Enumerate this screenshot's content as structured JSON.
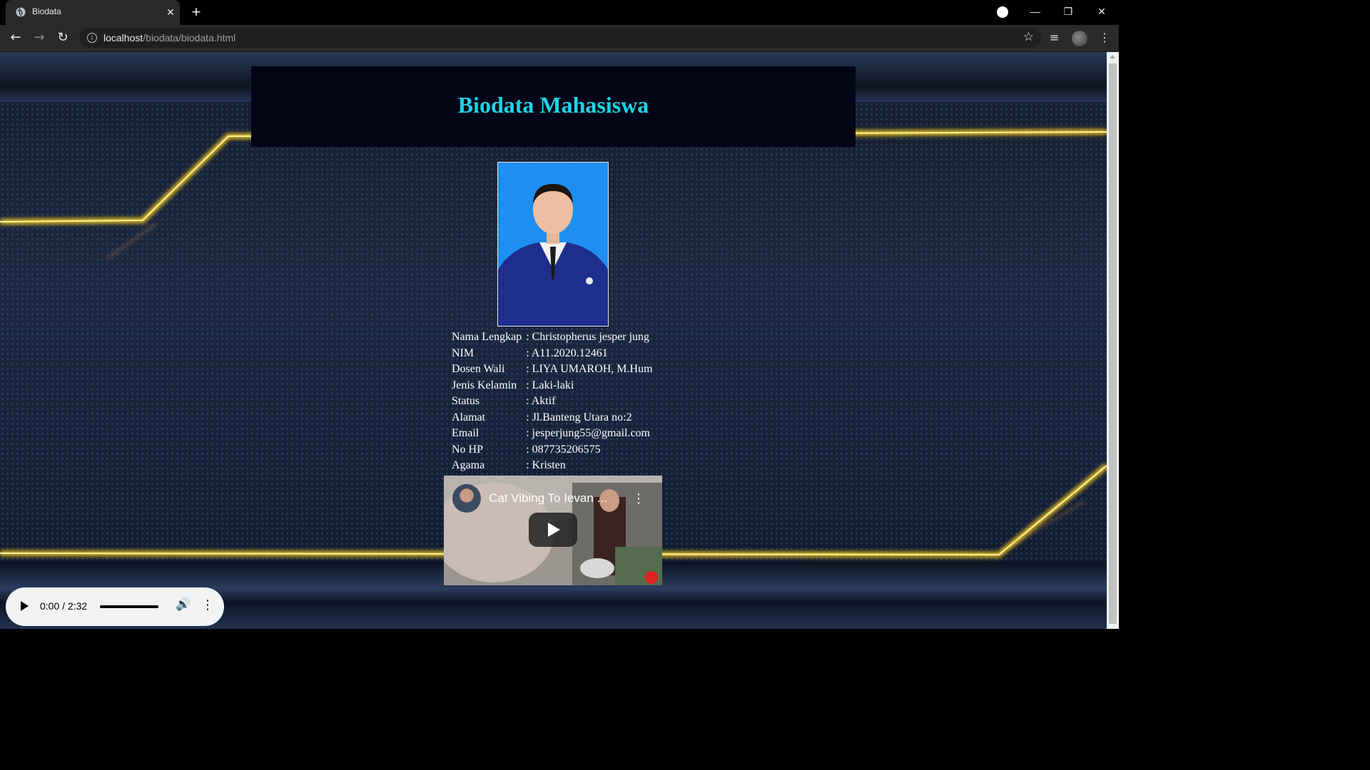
{
  "browser": {
    "tab_title": "Biodata",
    "tab_close": "✕",
    "new_tab": "+",
    "url_host": "localhost",
    "url_path": "/biodata/biodata.html",
    "minimize": "—",
    "restore": "❐",
    "close": "✕",
    "back": "←",
    "forward": "→",
    "reload": "↻",
    "star": "☆",
    "media": "≡",
    "menu": "⋮",
    "info": "i"
  },
  "page": {
    "title": "Biodata Mahasiswa"
  },
  "biodata": [
    {
      "label": "Nama Lengkap",
      "value": ": Christopherus jesper jung"
    },
    {
      "label": "NIM",
      "value": ": A11.2020.12461"
    },
    {
      "label": "Dosen Wali",
      "value": ": LIYA UMAROH, M.Hum"
    },
    {
      "label": "Jenis Kelamin",
      "value": ": Laki-laki"
    },
    {
      "label": "Status",
      "value": ": Aktif"
    },
    {
      "label": "Alamat",
      "value": ": Jl.Banteng Utara no:2"
    },
    {
      "label": "Email",
      "value": ": jesperjung55@gmail.com"
    },
    {
      "label": "No HP",
      "value": ": 087735206575"
    },
    {
      "label": "Agama",
      "value": ": Kristen"
    }
  ],
  "video": {
    "title": "Cat Vibing To Ievan ...",
    "menu": "⋮"
  },
  "audio": {
    "time": "0:00 / 2:32",
    "progress": 0,
    "volume_icon": "🔊",
    "menu": "⋮"
  },
  "colors": {
    "title": "#1fd3e6",
    "header_bg": "#030516",
    "accent_glow": "#ffd21a"
  }
}
